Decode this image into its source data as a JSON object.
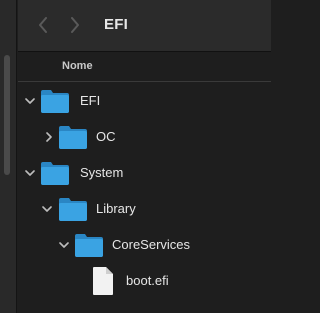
{
  "toolbar": {
    "title": "EFI"
  },
  "column_header": {
    "name_label": "Nome"
  },
  "rows": [
    {
      "label": "EFI",
      "type": "folder",
      "expanded": true,
      "depth": 0
    },
    {
      "label": "OC",
      "type": "folder",
      "expanded": false,
      "depth": 1
    },
    {
      "label": "System",
      "type": "folder",
      "expanded": true,
      "depth": 0
    },
    {
      "label": "Library",
      "type": "folder",
      "expanded": true,
      "depth": 1
    },
    {
      "label": "CoreServices",
      "type": "folder",
      "expanded": true,
      "depth": 2
    },
    {
      "label": "boot.efi",
      "type": "file",
      "depth": 3
    }
  ],
  "colors": {
    "folder_front": "#3aa3e3",
    "folder_back": "#2a86c4",
    "background": "#1e1e1e"
  }
}
